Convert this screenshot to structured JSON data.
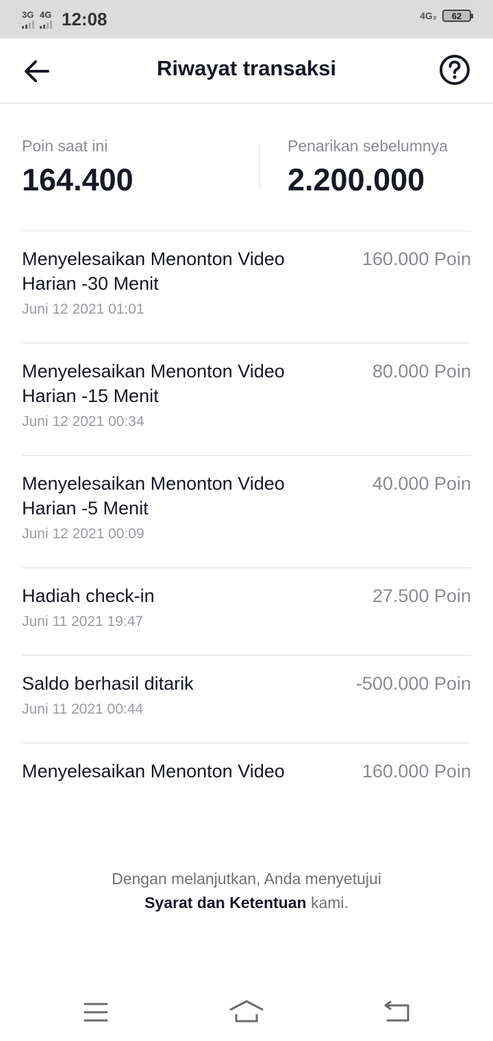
{
  "status_bar": {
    "sim1": "3G",
    "sim2": "4G",
    "time": "12:08",
    "network": "4G₂",
    "battery": "62"
  },
  "header": {
    "title": "Riwayat transaksi",
    "back_icon": "arrow-left-icon",
    "help_icon": "question-circle-icon"
  },
  "summary": {
    "current_label": "Poin saat ini",
    "current_value": "164.400",
    "previous_label": "Penarikan sebelumnya",
    "previous_value": "2.200.000"
  },
  "transactions": [
    {
      "title": "Menyelesaikan Menonton Video Harian -30 Menit",
      "amount": "160.000 Poin",
      "date": "Juni 12 2021 01:01"
    },
    {
      "title": "Menyelesaikan Menonton Video Harian -15 Menit",
      "amount": "80.000 Poin",
      "date": "Juni 12 2021 00:34"
    },
    {
      "title": "Menyelesaikan Menonton Video Harian -5 Menit",
      "amount": "40.000 Poin",
      "date": "Juni 12 2021 00:09"
    },
    {
      "title": "Hadiah check-in",
      "amount": "27.500 Poin",
      "date": "Juni 11 2021 19:47"
    },
    {
      "title": "Saldo berhasil ditarik",
      "amount": "-500.000 Poin",
      "date": "Juni 11 2021 00:44"
    },
    {
      "title": "Menyelesaikan Menonton Video",
      "amount": "160.000 Poin",
      "date": ""
    }
  ],
  "footer": {
    "line1": "Dengan melanjutkan, Anda menyetujui",
    "terms_link": "Syarat dan Ketentuan",
    "line2_suffix": "kami."
  },
  "navbar": {
    "menu_icon": "menu-icon",
    "home_icon": "home-icon",
    "back_icon": "back-icon"
  }
}
